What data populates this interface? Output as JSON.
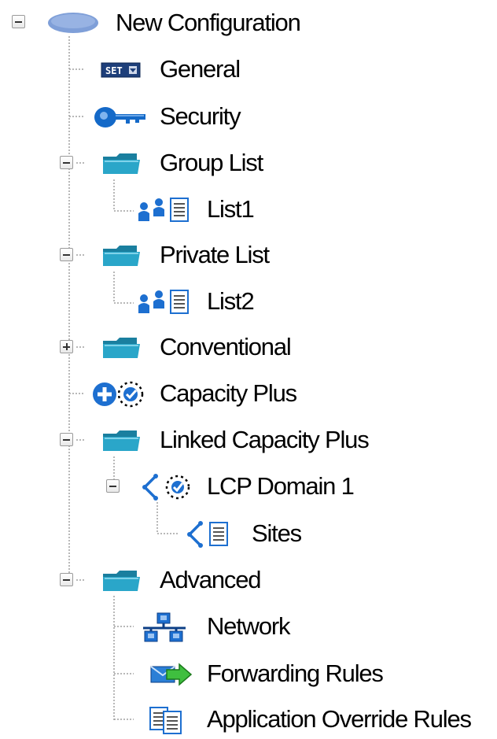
{
  "tree": {
    "root": {
      "label": "New Configuration",
      "icon": "cloud-icon"
    },
    "items": {
      "general": {
        "label": "General",
        "icon": "set-icon"
      },
      "security": {
        "label": "Security",
        "icon": "key-icon"
      },
      "group_list": {
        "label": "Group List",
        "icon": "folder-icon"
      },
      "list1": {
        "label": "List1",
        "icon": "user-list-icon"
      },
      "private_list": {
        "label": "Private List",
        "icon": "folder-icon"
      },
      "list2": {
        "label": "List2",
        "icon": "user-list-icon"
      },
      "conventional": {
        "label": "Conventional",
        "icon": "folder-icon"
      },
      "capacity_plus": {
        "label": "Capacity Plus",
        "icon": "capacity-plus-icon"
      },
      "linked_capacity_plus": {
        "label": "Linked Capacity Plus",
        "icon": "folder-icon"
      },
      "lcp_domain_1": {
        "label": "LCP Domain 1",
        "icon": "lcp-domain-icon"
      },
      "sites": {
        "label": "Sites",
        "icon": "sites-icon"
      },
      "advanced": {
        "label": "Advanced",
        "icon": "folder-icon"
      },
      "network": {
        "label": "Network",
        "icon": "network-icon"
      },
      "forwarding_rules": {
        "label": "Forwarding Rules",
        "icon": "forwarding-icon"
      },
      "application_override_rules": {
        "label": "Application Override Rules",
        "icon": "documents-icon"
      }
    }
  },
  "colors": {
    "folder": "#2aa6c9",
    "cloud": "#6d8fd1",
    "icon_blue": "#1d6fd0",
    "connector": "#a0a0a0"
  }
}
